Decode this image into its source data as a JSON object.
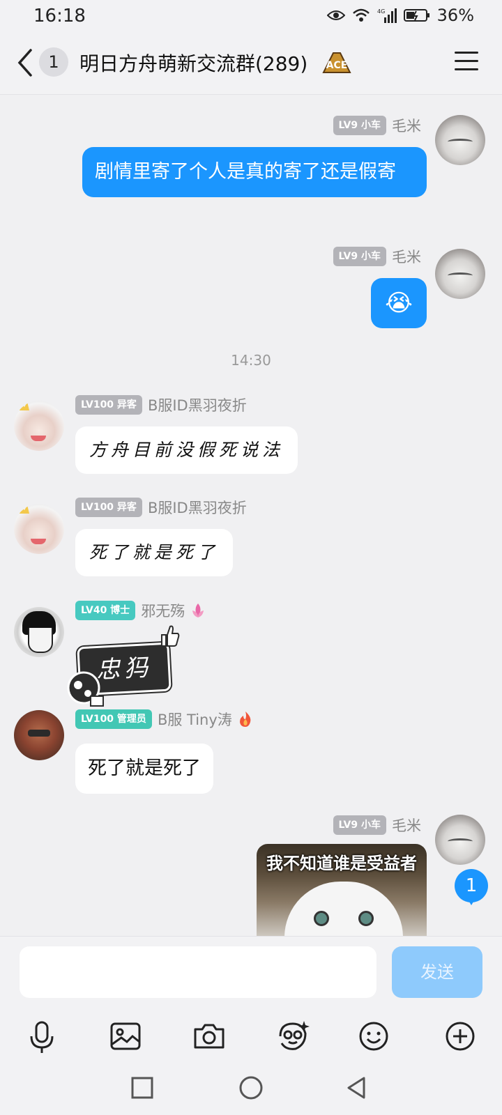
{
  "status": {
    "time": "16:18",
    "network": "4G",
    "battery": "36%"
  },
  "header": {
    "unread_count": "1",
    "title": "明日方舟萌新交流群(289)",
    "badge_icon": "ace-badge-icon"
  },
  "messages": [
    {
      "side": "right",
      "badge": "LV9 小车",
      "name": "毛米",
      "text": "剧情里寄了个人是真的寄了还是假寄"
    },
    {
      "side": "right",
      "badge": "LV9 小车",
      "name": "毛米",
      "emoji": "😭"
    },
    {
      "timestamp": "14:30"
    },
    {
      "side": "left",
      "badge": "LV100 异客",
      "name": "B服ID黑羽夜折",
      "text": "方舟目前没假死说法"
    },
    {
      "side": "left",
      "badge": "LV100 异客",
      "name": "B服ID黑羽夜折",
      "text": "死了就是死了"
    },
    {
      "side": "left",
      "badge": "LV40 博士",
      "name": "邪无殇",
      "sticker_text": "忠犸"
    },
    {
      "side": "left",
      "badge": "LV100 管理员",
      "name": "B服 Tiny涛",
      "text": "死了就是死了"
    },
    {
      "side": "right",
      "badge": "LV9 小车",
      "name": "毛米",
      "image_caption": "我不知道谁是受益者"
    }
  ],
  "new_message_count": "1",
  "composer": {
    "input_value": "",
    "send_label": "发送"
  },
  "toolbar": [
    "microphone-icon",
    "image-icon",
    "camera-icon",
    "sticker-face-icon",
    "emoji-icon",
    "plus-icon"
  ],
  "colors": {
    "accent": "#1b96fe",
    "background": "#f0f0f2",
    "bubble_them": "#ffffff",
    "badge_gray": "#b3b3b8",
    "badge_teal": "#47c9c0"
  }
}
